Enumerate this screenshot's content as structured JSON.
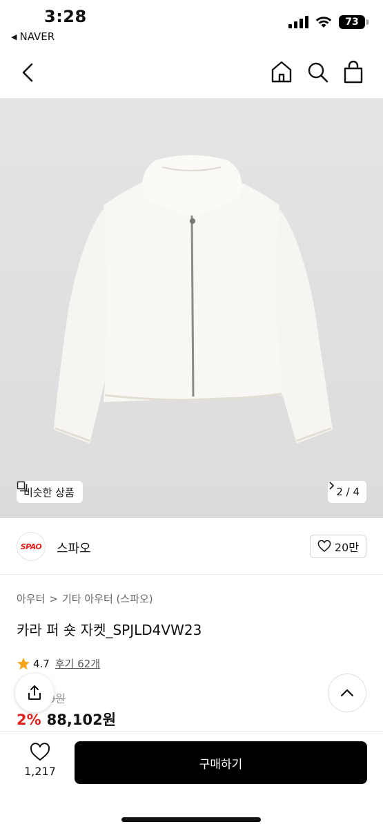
{
  "status": {
    "time": "3:28",
    "back_app": "NAVER",
    "battery": "73"
  },
  "nav": {
    "icons": [
      "chevron-left-icon",
      "home-icon",
      "search-icon",
      "shopping-bag-icon"
    ]
  },
  "hero": {
    "similar_label": "비슷한 상품",
    "pager": "2 / 4"
  },
  "brand": {
    "logo_text": "SPAO",
    "name": "스파오",
    "likes": "20만"
  },
  "product": {
    "breadcrumb_1": "아우터",
    "breadcrumb_2": "기타 아우터 (스파오)",
    "title": "카라 퍼 숏 자켓_SPJLD4VW23",
    "rating": "4.7",
    "reviews": "후기 62개",
    "original_price": "9원",
    "discount": "2%",
    "price": "88,102원"
  },
  "bottom": {
    "wish_count": "1,217",
    "buy_label": "구매하기"
  },
  "colors": {
    "accent_red": "#e0201d",
    "buy_button": "#000000"
  }
}
